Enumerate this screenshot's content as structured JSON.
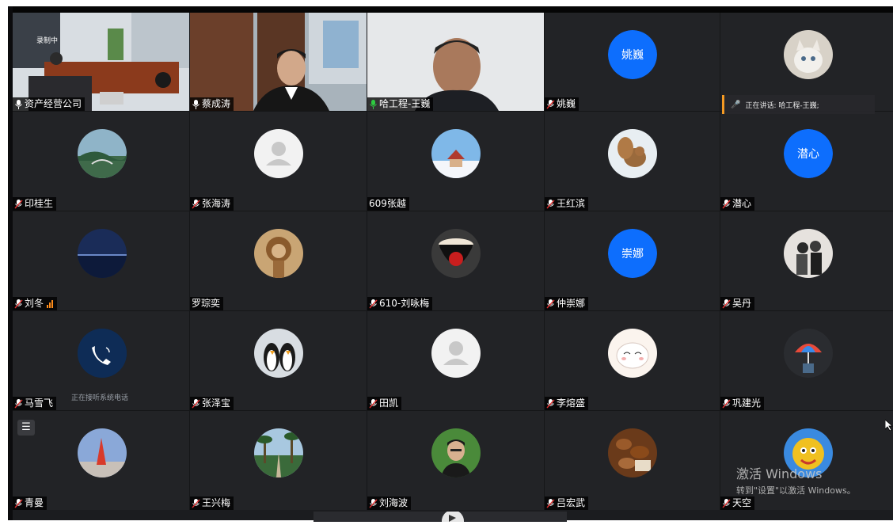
{
  "speaking_banner": "正在讲话: 哈工程-王巍;",
  "recording_label": "录制中",
  "activation": {
    "line1": "激活 Windows",
    "line2": "转到\"设置\"以激活 Windows。"
  },
  "tiles": [
    {
      "name": "资产经营公司"
    },
    {
      "name": "蔡成涛"
    },
    {
      "name": "哈工程-王巍"
    },
    {
      "name": "姚巍",
      "initials": "姚巍"
    },
    {
      "name": ""
    },
    {
      "name": "印桂生"
    },
    {
      "name": "张海涛"
    },
    {
      "name": "609张越"
    },
    {
      "name": "王红滨"
    },
    {
      "name": "潜心",
      "initials": "潜心"
    },
    {
      "name": "刘冬"
    },
    {
      "name": "罗琮奕"
    },
    {
      "name": "610-刘咏梅"
    },
    {
      "name": "仲崇娜",
      "initials": "崇娜"
    },
    {
      "name": "吴丹"
    },
    {
      "name": "马雪飞",
      "status": "正在接听系统电话"
    },
    {
      "name": "张泽宝"
    },
    {
      "name": "田凯"
    },
    {
      "name": "李熔盛"
    },
    {
      "name": "巩建光"
    },
    {
      "name": "青曼"
    },
    {
      "name": "王兴梅"
    },
    {
      "name": "刘海波"
    },
    {
      "name": "吕宏武"
    },
    {
      "name": "天空"
    }
  ]
}
